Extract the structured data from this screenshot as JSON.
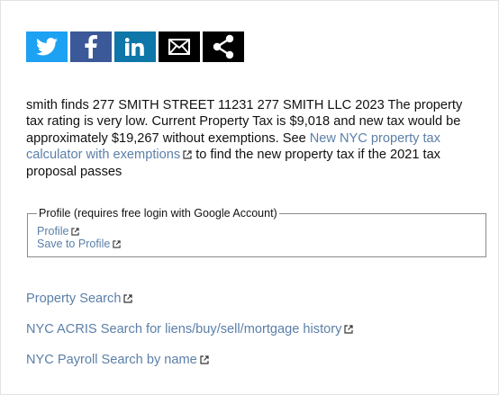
{
  "share": {
    "buttons": [
      {
        "name": "twitter",
        "color": "#1da1f2",
        "icon": "twitter-bird-icon"
      },
      {
        "name": "facebook",
        "color": "#3b5998",
        "icon": "facebook-f-icon"
      },
      {
        "name": "linkedin",
        "color": "#0e76a8",
        "icon": "linkedin-in-icon"
      },
      {
        "name": "email",
        "color": "#000000",
        "icon": "envelope-icon"
      },
      {
        "name": "share",
        "color": "#000000",
        "icon": "share-nodes-icon"
      }
    ]
  },
  "summary": {
    "before_link": "smith finds 277 SMITH STREET 11231 277 SMITH LLC 2023 The property tax rating is very low. Current Property Tax is $9,018 and new tax would be approximately $19,267 without exemptions. See ",
    "link_text": "New NYC property tax calculator with exemptions",
    "after_link": " to find the new property tax if the 2021 tax proposal passes"
  },
  "profile": {
    "legend": "Profile (requires free login with Google Account)",
    "links": [
      "Profile",
      "Save to Profile"
    ]
  },
  "links": {
    "property_search": "Property Search",
    "acris_search": "NYC ACRIS Search for liens/buy/sell/mortgage history",
    "payroll_search": "NYC Payroll Search by name"
  },
  "colors": {
    "link": "#5b7fa8",
    "text": "#111111"
  }
}
